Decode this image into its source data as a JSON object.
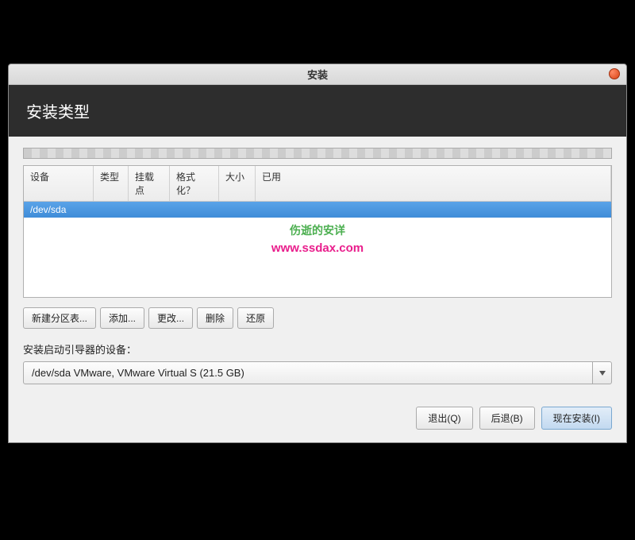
{
  "titlebar": {
    "title": "安装"
  },
  "header": {
    "title": "安装类型"
  },
  "table": {
    "headers": {
      "device": "设备",
      "type": "类型",
      "mount": "挂载点",
      "format": "格式化？",
      "size": "大小",
      "used": "已用"
    },
    "rows": [
      {
        "device": "/dev/sda"
      }
    ]
  },
  "watermark": {
    "line1": "伤逝的安详",
    "line2": "www.ssdax.com"
  },
  "buttons": {
    "new_table": "新建分区表...",
    "add": "添加...",
    "change": "更改...",
    "delete": "删除",
    "revert": "还原"
  },
  "bootloader": {
    "label": "安装启动引导器的设备：",
    "selected": "/dev/sda  VMware, VMware Virtual S (21.5 GB)"
  },
  "footer": {
    "quit": "退出(Q)",
    "back": "后退(B)",
    "install": "现在安装(I)"
  }
}
